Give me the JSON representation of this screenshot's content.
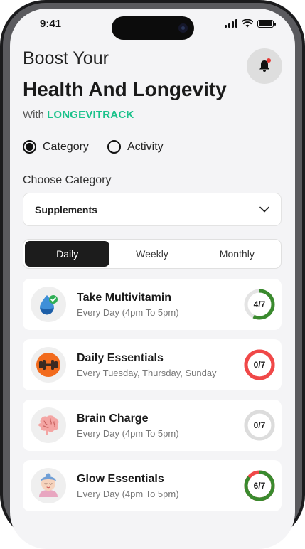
{
  "status_bar": {
    "time": "9:41"
  },
  "header": {
    "line1": "Boost Your",
    "line2": "Health And Longevity",
    "with_text": "With",
    "brand": "LONGEVITRACK"
  },
  "mode_options": [
    {
      "label": "Category",
      "selected": true
    },
    {
      "label": "Activity",
      "selected": false
    }
  ],
  "category": {
    "label": "Choose Category",
    "selected_value": "Supplements"
  },
  "period_tabs": [
    {
      "label": "Daily",
      "active": true
    },
    {
      "label": "Weekly",
      "active": false
    },
    {
      "label": "Monthly",
      "active": false
    }
  ],
  "tasks": [
    {
      "title": "Take Multivitamin",
      "schedule": "Every Day (4pm To 5pm)",
      "progress": "4/7",
      "done": 4,
      "total": 7,
      "color": "#3a8a2e",
      "icon": "water-drop-check-icon"
    },
    {
      "title": "Daily Essentials",
      "schedule": "Every Tuesday, Thursday, Sunday",
      "progress": "0/7",
      "done": 0,
      "total": 7,
      "color": "#f04848",
      "icon": "dumbbell-icon"
    },
    {
      "title": "Brain Charge",
      "schedule": "Every Day (4pm To 5pm)",
      "progress": "0/7",
      "done": 0,
      "total": 7,
      "color": "#dcdcdc",
      "icon": "brain-icon"
    },
    {
      "title": "Glow Essentials",
      "schedule": "Every Day (4pm To 5pm)",
      "progress": "6/7",
      "done": 6,
      "total": 7,
      "color": "#3a8a2e",
      "icon": "face-mask-icon"
    }
  ],
  "colors": {
    "brand": "#1cc28b",
    "active_tab": "#1c1c1c",
    "notification_dot": "#e53935"
  }
}
